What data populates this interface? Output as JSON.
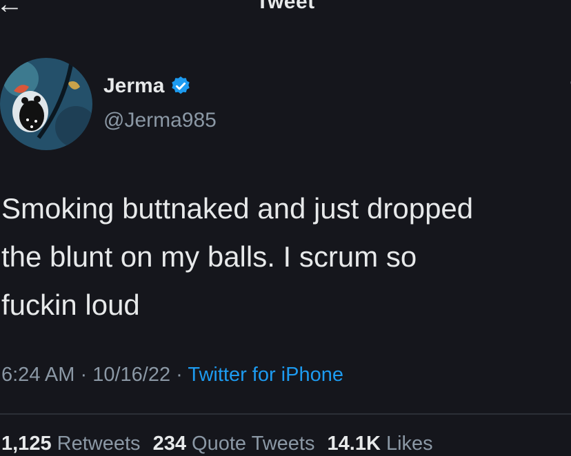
{
  "header": {
    "title": "Tweet",
    "back_icon": "arrow-left-icon"
  },
  "author": {
    "name": "Jerma",
    "handle": "@Jerma985",
    "verified_icon": "verified-badge-icon",
    "verified_color": "#1d9bf0"
  },
  "tweet": {
    "text": "Smoking buttnaked and just dropped\nthe blunt on my balls. I scrum so\nfuckin loud",
    "time": "6:24 AM",
    "date": "10/16/22",
    "source": "Twitter for iPhone",
    "separator": " · "
  },
  "stats": {
    "retweets_count": "1,125",
    "retweets_label": "Retweets",
    "quotes_count": "234",
    "quotes_label": "Quote Tweets",
    "likes_count": "14.1K",
    "likes_label": "Likes"
  },
  "colors": {
    "background": "#15161c",
    "text": "#e7e9ea",
    "secondary": "#8b98a5",
    "accent": "#1d9bf0"
  }
}
